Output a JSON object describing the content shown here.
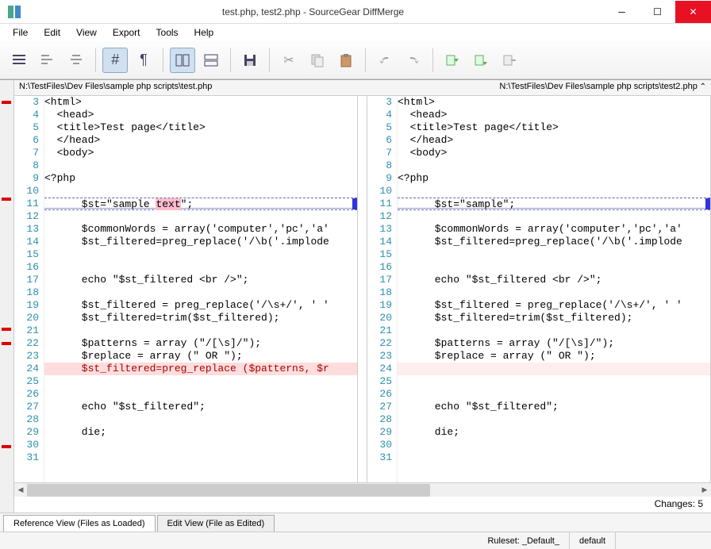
{
  "window": {
    "title": "test.php, test2.php - SourceGear DiffMerge"
  },
  "menu": {
    "file": "File",
    "edit": "Edit",
    "view": "View",
    "export": "Export",
    "tools": "Tools",
    "help": "Help"
  },
  "toolbar_icons": {
    "align_all": "align-all",
    "align_left": "align-left",
    "align_center": "align-center",
    "hash": "hash",
    "pilcrow": "pilcrow",
    "split_v": "split-vertical",
    "split_h": "split-horizontal",
    "save": "save",
    "cut": "cut",
    "copy": "copy",
    "paste": "paste",
    "undo": "undo",
    "redo": "redo",
    "next_diff": "next-diff",
    "prev_diff": "prev-diff",
    "merge": "merge"
  },
  "files": {
    "left": "N:\\TestFiles\\Dev Files\\sample php scripts\\test.php",
    "right": "N:\\TestFiles\\Dev Files\\sample php scripts\\test2.php"
  },
  "left_lines": [
    {
      "n": 3,
      "t": "<html>"
    },
    {
      "n": 4,
      "t": "  <head>"
    },
    {
      "n": 5,
      "t": "  <title>Test page</title>"
    },
    {
      "n": 6,
      "t": "  </head>"
    },
    {
      "n": 7,
      "t": "  <body>"
    },
    {
      "n": 8,
      "t": ""
    },
    {
      "n": 9,
      "t": "<?php"
    },
    {
      "n": 10,
      "t": ""
    },
    {
      "n": 11,
      "t": "      $st=\"sample text\";",
      "hl": "word",
      "hlseg": "text"
    },
    {
      "n": 12,
      "t": ""
    },
    {
      "n": 13,
      "t": "      $commonWords = array('computer','pc','a'"
    },
    {
      "n": 14,
      "t": "      $st_filtered=preg_replace('/\\b('.implode"
    },
    {
      "n": 15,
      "t": ""
    },
    {
      "n": 16,
      "t": ""
    },
    {
      "n": 17,
      "t": "      echo \"$st_filtered <br />\";"
    },
    {
      "n": 18,
      "t": ""
    },
    {
      "n": 19,
      "t": "      $st_filtered = preg_replace('/\\s+/', ' '"
    },
    {
      "n": 20,
      "t": "      $st_filtered=trim($st_filtered);"
    },
    {
      "n": 21,
      "t": ""
    },
    {
      "n": 22,
      "t": "      $patterns = array (\"/[\\s]/\");"
    },
    {
      "n": 23,
      "t": "      $replace = array (\" OR \");"
    },
    {
      "n": 24,
      "t": "      $st_filtered=preg_replace ($patterns, $r",
      "hl": "del"
    },
    {
      "n": 25,
      "t": ""
    },
    {
      "n": 26,
      "t": ""
    },
    {
      "n": 27,
      "t": "      echo \"$st_filtered\";"
    },
    {
      "n": 28,
      "t": ""
    },
    {
      "n": 29,
      "t": "      die;"
    },
    {
      "n": 30,
      "t": ""
    },
    {
      "n": 31,
      "t": ""
    }
  ],
  "right_lines": [
    {
      "n": 3,
      "t": "<html>"
    },
    {
      "n": 4,
      "t": "  <head>"
    },
    {
      "n": 5,
      "t": "  <title>Test page</title>"
    },
    {
      "n": 6,
      "t": "  </head>"
    },
    {
      "n": 7,
      "t": "  <body>"
    },
    {
      "n": 8,
      "t": ""
    },
    {
      "n": 9,
      "t": "<?php"
    },
    {
      "n": 10,
      "t": ""
    },
    {
      "n": 11,
      "t": "      $st=\"sample\";",
      "hl": "word"
    },
    {
      "n": 12,
      "t": ""
    },
    {
      "n": 13,
      "t": "      $commonWords = array('computer','pc','a'"
    },
    {
      "n": 14,
      "t": "      $st_filtered=preg_replace('/\\b('.implode"
    },
    {
      "n": 15,
      "t": ""
    },
    {
      "n": 16,
      "t": ""
    },
    {
      "n": 17,
      "t": "      echo \"$st_filtered <br />\";"
    },
    {
      "n": 18,
      "t": ""
    },
    {
      "n": 19,
      "t": "      $st_filtered = preg_replace('/\\s+/', ' '"
    },
    {
      "n": 20,
      "t": "      $st_filtered=trim($st_filtered);"
    },
    {
      "n": 21,
      "t": ""
    },
    {
      "n": 22,
      "t": "      $patterns = array (\"/[\\s]/\");"
    },
    {
      "n": 23,
      "t": "      $replace = array (\" OR \");"
    },
    {
      "n": 24,
      "t": "",
      "hl": "light"
    },
    {
      "n": 25,
      "t": ""
    },
    {
      "n": 26,
      "t": ""
    },
    {
      "n": 27,
      "t": "      echo \"$st_filtered\";"
    },
    {
      "n": 28,
      "t": ""
    },
    {
      "n": 29,
      "t": "      die;"
    },
    {
      "n": 30,
      "t": ""
    },
    {
      "n": 31,
      "t": ""
    }
  ],
  "changes": {
    "label": "Changes: 5"
  },
  "tabs": {
    "ref": "Reference View (Files as Loaded)",
    "edit": "Edit View (File as Edited)"
  },
  "status": {
    "ruleset_label": "Ruleset:",
    "ruleset_value": "_Default_",
    "encoding": "default"
  },
  "diff_markers": [
    26,
    148,
    312,
    330,
    460
  ]
}
